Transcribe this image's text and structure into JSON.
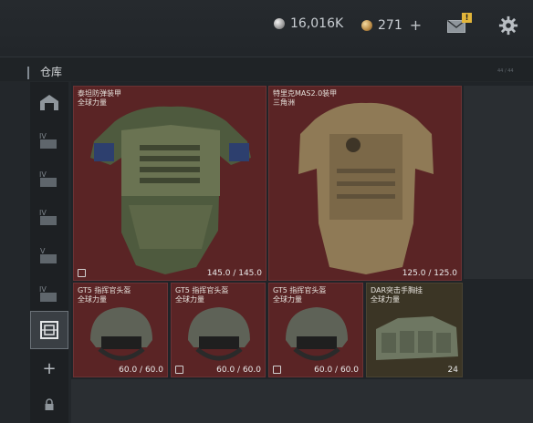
{
  "currency": {
    "silver": "16,016K",
    "gold": "271",
    "plus": "+"
  },
  "mail_badge": "!",
  "header": {
    "title": "仓库",
    "meta": "44 / 44"
  },
  "sidebar": {
    "add": "+"
  },
  "items": [
    {
      "name": "泰坦防弹装甲",
      "sub": "全球力量",
      "value": "145.0 / 145.0"
    },
    {
      "name": "特里克MAS2.0装甲",
      "sub": "三角洲",
      "value": "125.0 / 125.0"
    },
    {
      "name": "GT5 指挥官头盔",
      "sub": "全球力量",
      "value": "60.0 / 60.0"
    },
    {
      "name": "GT5 指挥官头盔",
      "sub": "全球力量",
      "value": "60.0 / 60.0"
    },
    {
      "name": "GT5 指挥官头盔",
      "sub": "全球力量",
      "value": "60.0 / 60.0"
    },
    {
      "name": "DAR突击手胸挂",
      "sub": "全球力量",
      "value": "24"
    }
  ],
  "icons": {
    "silver": "silver-coin-icon",
    "gold": "gold-coin-icon",
    "mail": "mail-icon",
    "settings": "gear-icon",
    "lock": "lock-icon"
  }
}
